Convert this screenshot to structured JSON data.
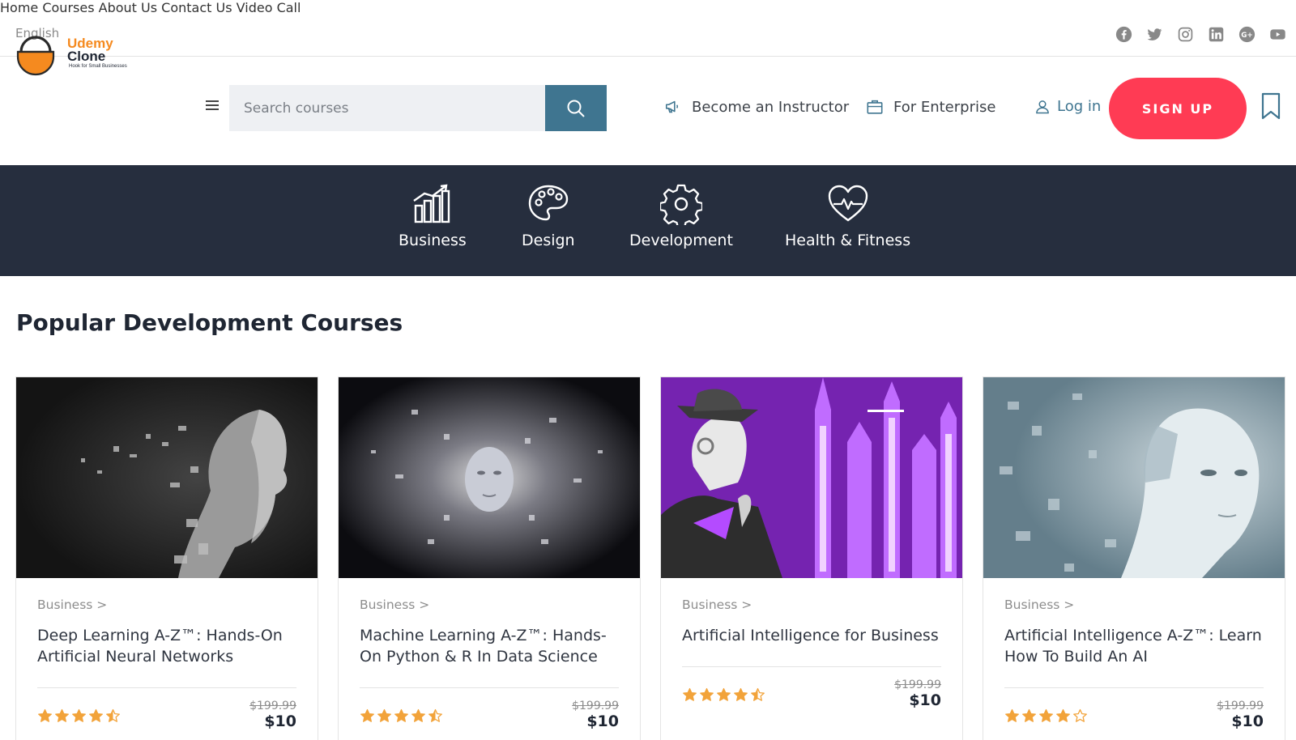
{
  "topbar": {
    "language": "English",
    "nav": [
      "Home",
      "Courses",
      "About Us",
      "Contact Us",
      "Video Call"
    ],
    "social_icons": [
      "facebook-icon",
      "twitter-icon",
      "instagram-icon",
      "linkedin-icon",
      "google-plus-icon",
      "youtube-icon"
    ]
  },
  "header": {
    "logo_line1": "Udemy",
    "logo_line2": "Clone",
    "logo_tagline": "Hook for Small Businesses",
    "search_placeholder": "Search courses",
    "become_instructor": "Become an Instructor",
    "for_enterprise": "For Enterprise",
    "login": "Log in",
    "signup": "SIGN UP"
  },
  "categories": [
    {
      "label": "Business",
      "icon": "bar-chart-icon"
    },
    {
      "label": "Design",
      "icon": "palette-icon"
    },
    {
      "label": "Development",
      "icon": "gear-icon"
    },
    {
      "label": "Health & Fitness",
      "icon": "heartbeat-icon"
    }
  ],
  "section_title": "Popular Development Courses",
  "courses": [
    {
      "category": "Business >",
      "title": "Deep Learning A-Z™: Hands-On Artificial Neural Networks",
      "old_price": "$199.99",
      "price": "$10",
      "rating": 4.5
    },
    {
      "category": "Business >",
      "title": "Machine Learning A-Z™: Hands-On Python & R In Data Science",
      "old_price": "$199.99",
      "price": "$10",
      "rating": 4.5
    },
    {
      "category": "Business >",
      "title": "Artificial Intelligence for Business",
      "old_price": "$199.99",
      "price": "$10",
      "rating": 4.5
    },
    {
      "category": "Business >",
      "title": "Artificial Intelligence A-Z™: Learn How To Build An AI",
      "old_price": "$199.99",
      "price": "$10",
      "rating": 4
    }
  ],
  "colors": {
    "accent": "#3f7590",
    "signup": "#ff3b54",
    "category_band": "#262e3e",
    "logo_orange": "#f58a1f",
    "star": "#f2a33a"
  }
}
